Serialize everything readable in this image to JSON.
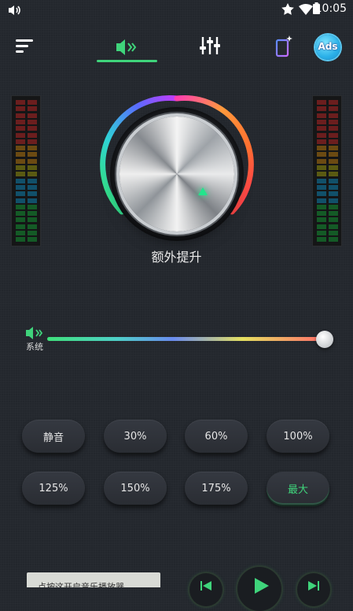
{
  "status_bar": {
    "time": "10:05"
  },
  "nav": {
    "tabs": [
      "volume",
      "equalizer"
    ],
    "active_tab": "volume",
    "ads_label": "Ads"
  },
  "dial": {
    "label": "额外提升"
  },
  "slider": {
    "label": "系统",
    "value_fraction": 0.97
  },
  "presets": [
    "静音",
    "30%",
    "60%",
    "100%",
    "125%",
    "150%",
    "175%",
    "最大"
  ],
  "active_preset": "最大",
  "player": {
    "text": "点按这开启音乐播放器"
  },
  "colors": {
    "accent": "#3fd47b",
    "background": "#23272d"
  }
}
